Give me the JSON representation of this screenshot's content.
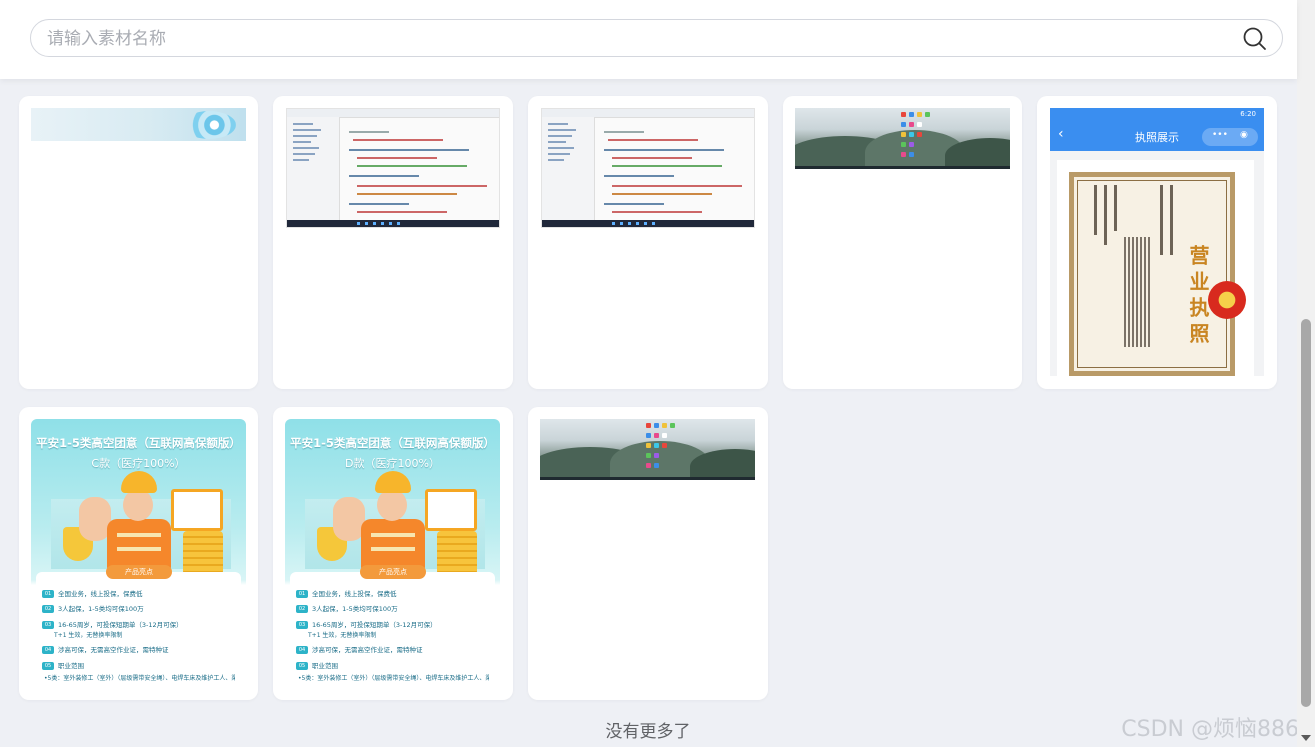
{
  "search": {
    "placeholder": "请输入素材名称"
  },
  "grid": {
    "cards": [
      {
        "kind": "banner"
      },
      {
        "kind": "ide-screenshot"
      },
      {
        "kind": "ide-screenshot"
      },
      {
        "kind": "landscape-desktop"
      },
      {
        "kind": "license-phone",
        "phone_title": "执照展示",
        "status_time": "6:20",
        "license_heading": "营业执照"
      },
      {
        "kind": "insurance-poster",
        "title": "平安1-5类高空团意（互联网高保额版）",
        "subtitle": "C款（医疗100%）",
        "tab": "产品亮点",
        "rows": [
          "全国业务，线上投保，保费低",
          "3人起保，1-5类均可保100万",
          "16-65周岁，可投保短期单（3-12月可保）",
          "涉高可保，无需高空作业证，需特种证",
          "职业范围"
        ],
        "row_numbers": [
          "01",
          "02",
          "03",
          "04",
          "05"
        ],
        "row3_extra": "T+1 生效，无替换率限制",
        "row5_extra": "•5类：室外装修工（室外）（层级需带安全绳）、电焊车床及维护工人、渠道运输工程人员(非驾驶人员)、普通专职货车驾驶"
      },
      {
        "kind": "insurance-poster",
        "title": "平安1-5类高空团意（互联网高保额版）",
        "subtitle": "D款（医疗100%）",
        "tab": "产品亮点",
        "rows": [
          "全国业务，线上投保，保费低",
          "3人起保，1-5类均可保100万",
          "16-65周岁，可投保短期单（3-12月可保）",
          "涉高可保，无需高空作业证，需特种证",
          "职业范围"
        ],
        "row_numbers": [
          "01",
          "02",
          "03",
          "04",
          "05"
        ],
        "row3_extra": "T+1 生效，无替换率限制",
        "row5_extra": "•5类：室外装修工（室外）（层级需带安全绳）、电焊车床及维护工人、渠道运输工程人员(非驾驶人员)、普通专职货车驾驶"
      },
      {
        "kind": "landscape-desktop"
      }
    ]
  },
  "footer": {
    "no_more_text": "没有更多了"
  },
  "watermark": {
    "text": "CSDN @烦恼886"
  },
  "icons": {
    "search": "search-icon",
    "scroll_down": "chevron-down-icon"
  },
  "colors": {
    "background": "#eef0f5",
    "card": "#ffffff",
    "phone_header": "#3a8ef0",
    "poster_accent": "#2db3c8"
  }
}
